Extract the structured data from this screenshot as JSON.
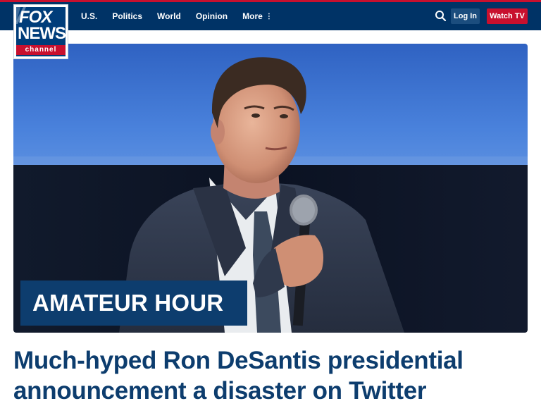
{
  "logo": {
    "line1": "FOX",
    "line2": "NEWS",
    "line3": "channel"
  },
  "nav": {
    "items": [
      {
        "label": "U.S."
      },
      {
        "label": "Politics"
      },
      {
        "label": "World"
      },
      {
        "label": "Opinion"
      },
      {
        "label": "More"
      }
    ],
    "more_icon": "vertical-dots-icon",
    "search_icon": "search-icon",
    "login_label": "Log In",
    "watch_label": "Watch TV"
  },
  "hero": {
    "tag": "AMATEUR HOUR",
    "headline": "Much-hyped Ron DeSantis presidential announcement a disaster on Twitter"
  },
  "colors": {
    "nav_background": "#003366",
    "brand_red": "#c8102e",
    "headline_blue": "#0d3d6e",
    "login_button": "#1b4d7e"
  }
}
